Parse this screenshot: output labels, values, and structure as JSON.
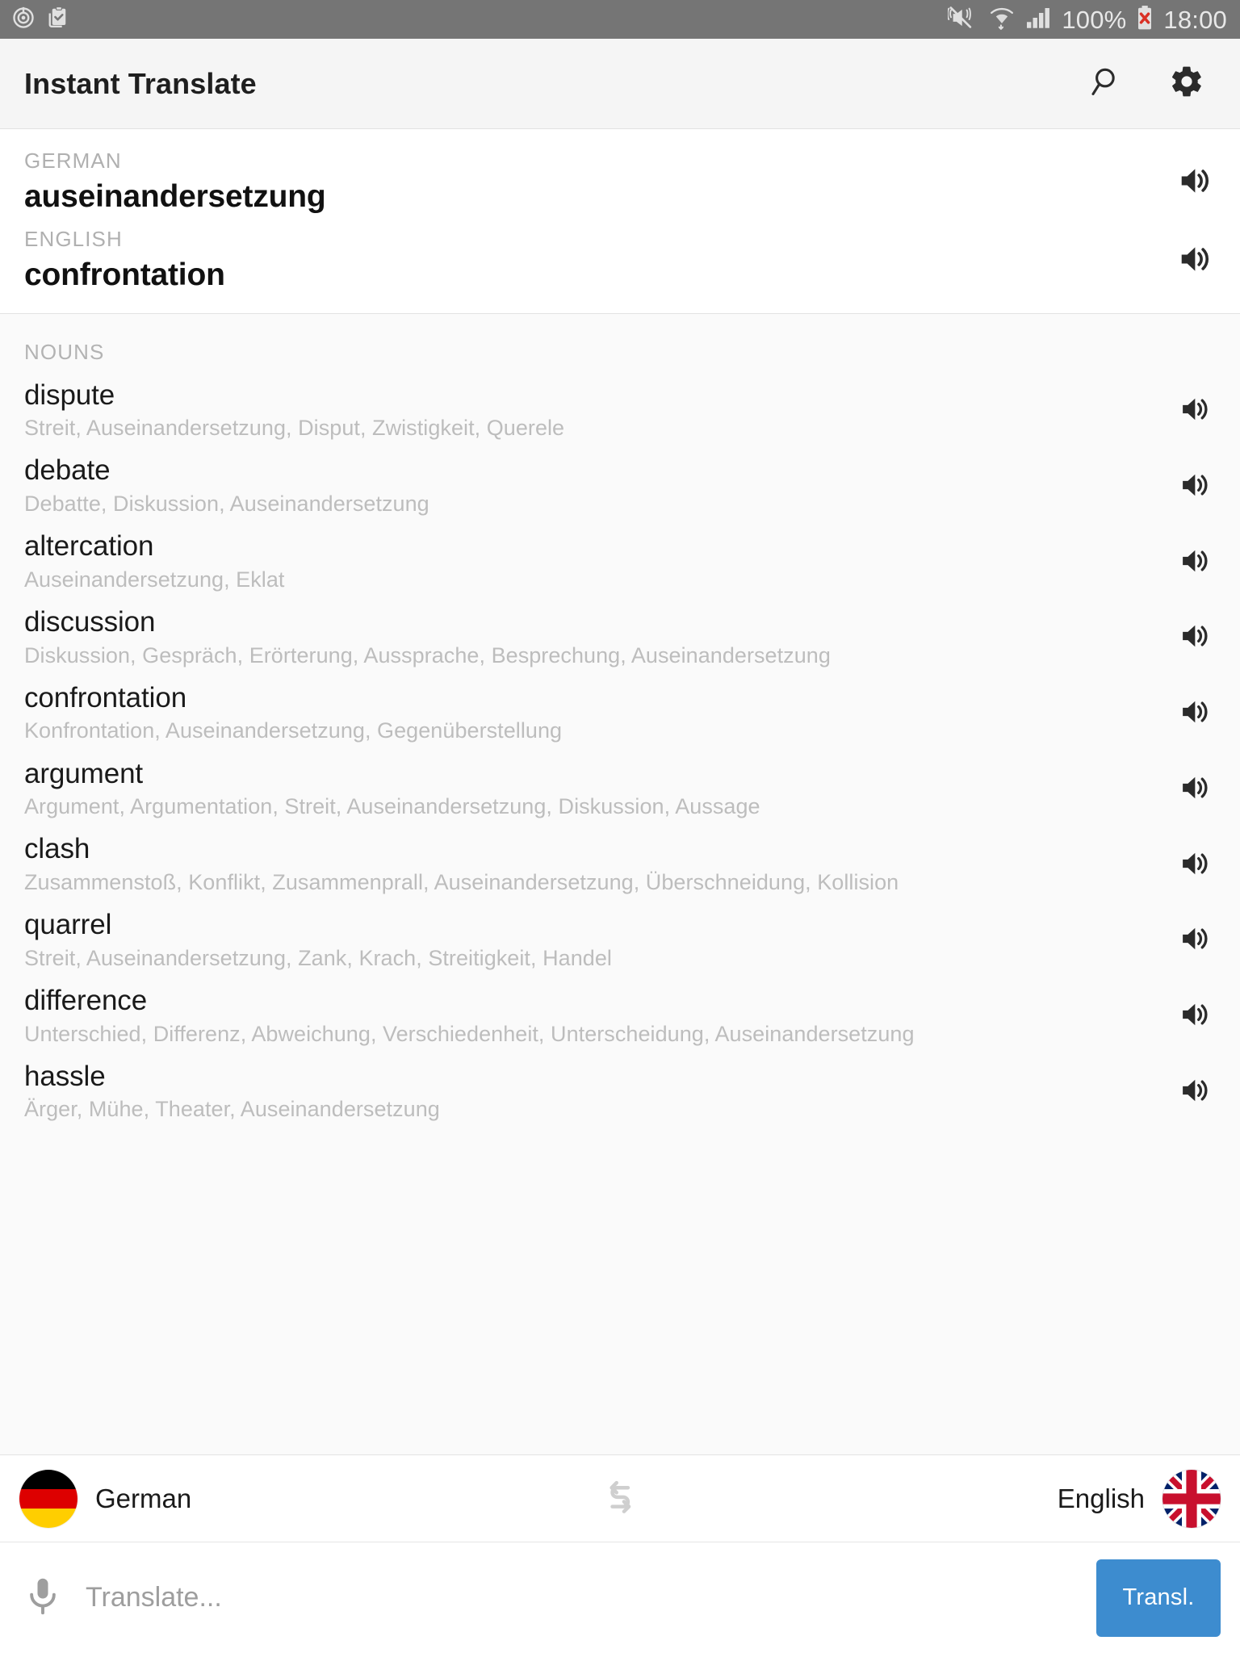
{
  "statusbar": {
    "left_icons": [
      "alarm-target-icon",
      "clipboard-check-icon"
    ],
    "right_icons": [
      "vibrate-mute-icon",
      "wifi-icon",
      "signal-icon",
      "battery-error-icon"
    ],
    "battery_percent": "100%",
    "clock": "18:00"
  },
  "appbar": {
    "title": "Instant Translate",
    "actions": [
      {
        "name": "search-icon",
        "label": "Search"
      },
      {
        "name": "gear-icon",
        "label": "Settings"
      }
    ]
  },
  "translation": {
    "source": {
      "lang_label": "GERMAN",
      "word": "auseinandersetzung",
      "speaker": "speaker-icon"
    },
    "target": {
      "lang_label": "ENGLISH",
      "word": "confrontation",
      "speaker": "speaker-icon"
    }
  },
  "nouns": {
    "section_label": "NOUNS",
    "items": [
      {
        "word": "dispute",
        "synonyms": "Streit, Auseinandersetzung, Disput, Zwistigkeit, Querele"
      },
      {
        "word": "debate",
        "synonyms": "Debatte, Diskussion, Auseinandersetzung"
      },
      {
        "word": "altercation",
        "synonyms": "Auseinandersetzung, Eklat"
      },
      {
        "word": "discussion",
        "synonyms": "Diskussion, Gespräch, Erörterung, Aussprache, Besprechung, Auseinandersetzung"
      },
      {
        "word": "confrontation",
        "synonyms": "Konfrontation, Auseinandersetzung, Gegenüberstellung"
      },
      {
        "word": "argument",
        "synonyms": "Argument, Argumentation, Streit, Auseinandersetzung, Diskussion, Aussage"
      },
      {
        "word": "clash",
        "synonyms": "Zusammenstoß, Konflikt, Zusammenprall, Auseinandersetzung, Überschneidung, Kollision"
      },
      {
        "word": "quarrel",
        "synonyms": "Streit, Auseinandersetzung, Zank, Krach, Streitigkeit, Handel"
      },
      {
        "word": "difference",
        "synonyms": "Unterschied, Differenz, Abweichung, Verschiedenheit, Unterscheidung, Auseinandersetzung"
      },
      {
        "word": "hassle",
        "synonyms": "Ärger, Mühe, Theater, Auseinandersetzung"
      }
    ]
  },
  "langbar": {
    "source_language": "German",
    "source_flag": "german-flag-icon",
    "target_language": "English",
    "target_flag": "uk-flag-icon",
    "swap_icon": "swap-languages-icon"
  },
  "inputbar": {
    "mic_icon": "microphone-icon",
    "input_value": "",
    "input_placeholder": "Translate...",
    "translate_button": "Transl."
  },
  "colors": {
    "statusbar_bg": "#757575",
    "appbar_bg": "#f5f5f5",
    "accent_button": "#3d8ccf",
    "section_bg": "#fafafa",
    "muted_text": "#bdbdbd"
  }
}
